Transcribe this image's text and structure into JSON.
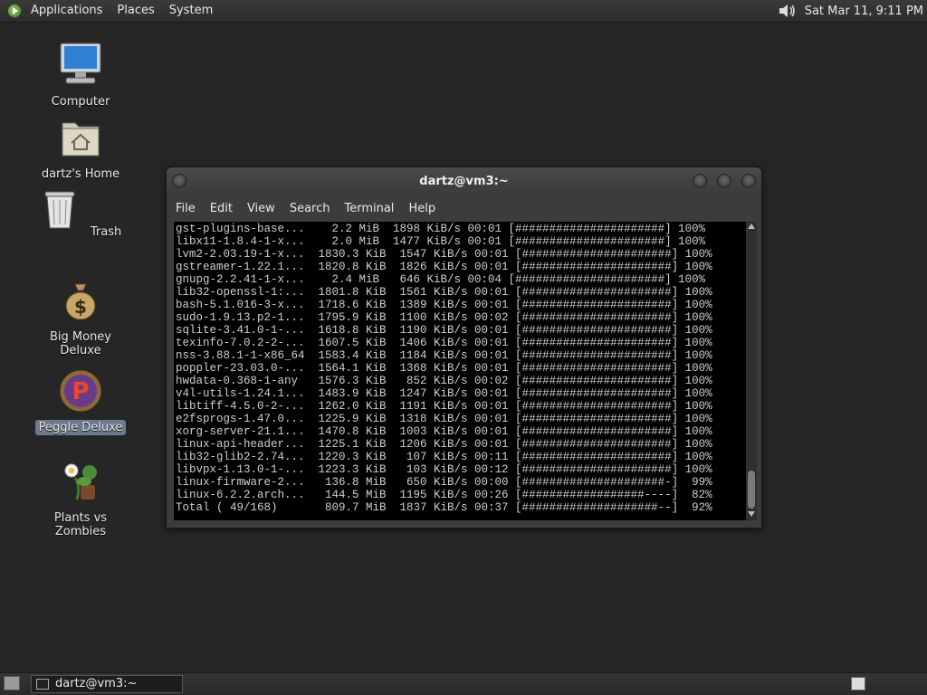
{
  "top_panel": {
    "menus": [
      "Applications",
      "Places",
      "System"
    ],
    "clock": "Sat Mar 11,  9:11 PM"
  },
  "desktop": {
    "icons": [
      {
        "label": "Computer",
        "icon": "computer-icon"
      },
      {
        "label": "dartz's Home",
        "icon": "home-folder-icon"
      },
      {
        "label": "Trash",
        "icon": "trash-icon"
      },
      {
        "label": "Big Money Deluxe",
        "icon": "money-bag-icon"
      },
      {
        "label": "Peggle Deluxe",
        "icon": "peggle-icon",
        "selected": true
      },
      {
        "label": "Plants vs Zombies",
        "icon": "plants-vs-zombies-icon"
      }
    ]
  },
  "terminal": {
    "title": "dartz@vm3:~",
    "menus": [
      "File",
      "Edit",
      "View",
      "Search",
      "Terminal",
      "Help"
    ],
    "lines": [
      "gst-plugins-base...    2.2 MiB  1898 KiB/s 00:01 [######################] 100%",
      "libx11-1.8.4-1-x...    2.0 MiB  1477 KiB/s 00:01 [######################] 100%",
      "lvm2-2.03.19-1-x...  1830.3 KiB  1547 KiB/s 00:01 [######################] 100%",
      "gstreamer-1.22.1...  1820.8 KiB  1826 KiB/s 00:01 [######################] 100%",
      "gnupg-2.2.41-1-x...    2.4 MiB   646 KiB/s 00:04 [######################] 100%",
      "lib32-openssl-1:...  1801.8 KiB  1561 KiB/s 00:01 [######################] 100%",
      "bash-5.1.016-3-x...  1718.6 KiB  1389 KiB/s 00:01 [######################] 100%",
      "sudo-1.9.13.p2-1...  1795.9 KiB  1100 KiB/s 00:02 [######################] 100%",
      "sqlite-3.41.0-1-...  1618.8 KiB  1190 KiB/s 00:01 [######################] 100%",
      "texinfo-7.0.2-2-...  1607.5 KiB  1406 KiB/s 00:01 [######################] 100%",
      "nss-3.88.1-1-x86_64  1583.4 KiB  1184 KiB/s 00:01 [######################] 100%",
      "poppler-23.03.0-...  1564.1 KiB  1368 KiB/s 00:01 [######################] 100%",
      "hwdata-0.368-1-any   1576.3 KiB   852 KiB/s 00:02 [######################] 100%",
      "v4l-utils-1.24.1...  1483.9 KiB  1247 KiB/s 00:01 [######################] 100%",
      "libtiff-4.5.0-2-...  1262.0 KiB  1191 KiB/s 00:01 [######################] 100%",
      "e2fsprogs-1.47.0...  1225.9 KiB  1318 KiB/s 00:01 [######################] 100%",
      "xorg-server-21.1...  1470.8 KiB  1003 KiB/s 00:01 [######################] 100%",
      "linux-api-header...  1225.1 KiB  1206 KiB/s 00:01 [######################] 100%",
      "lib32-glib2-2.74...  1220.3 KiB   107 KiB/s 00:11 [######################] 100%",
      "libvpx-1.13.0-1-...  1223.3 KiB   103 KiB/s 00:12 [######################] 100%",
      "linux-firmware-2...   136.8 MiB   650 KiB/s 00:00 [#####################-]  99%",
      "linux-6.2.2.arch...   144.5 MiB  1195 KiB/s 00:26 [##################----]  82%",
      "Total ( 49/168)       809.7 MiB  1837 KiB/s 00:37 [####################--]  92%"
    ]
  },
  "taskbar": {
    "task_label": "dartz@vm3:~"
  }
}
